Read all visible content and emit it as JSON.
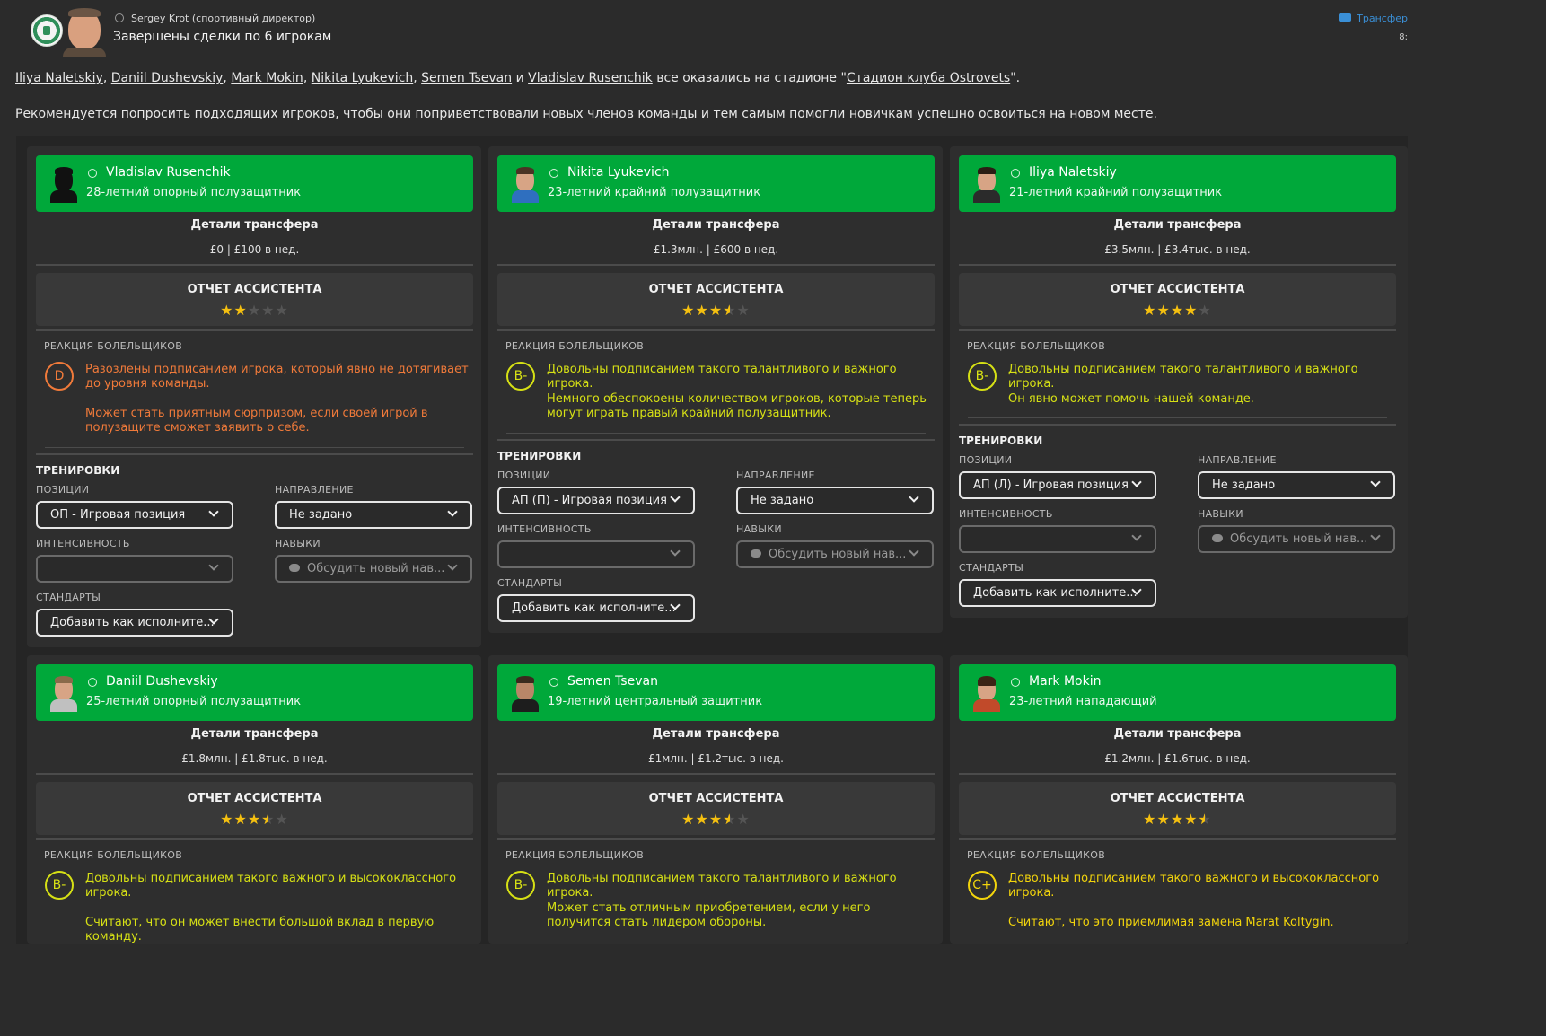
{
  "header": {
    "sender": "Sergey Krot  (спортивный директор)",
    "subject": "Завершены сделки по 6 игрокам",
    "category": "Трансфер",
    "time": "8:"
  },
  "body": {
    "players_line": [
      "Iliya Naletskiy",
      "Daniil Dushevskiy",
      "Mark Mokin",
      "Nikita Lyukevich",
      "Semen Tsevan",
      "Vladislav Rusenchik"
    ],
    "and_word": "и",
    "line1_middle": "все оказались на стадионе \"",
    "stadium": "Стадион клуба Ostrovets",
    "line1_end": "\".",
    "line2": "Рекомендуется попросить подходящих игроков, чтобы они поприветствовали новых членов команды и тем самым помогли новичкам успешно освоиться на новом месте."
  },
  "labels": {
    "transfer_details": "Детали трансфера",
    "assistant_report": "ОТЧЕТ АССИСТЕНТА",
    "fan_reaction": "РЕАКЦИЯ БОЛЕЛЬЩИКОВ",
    "training": "ТРЕНИРОВКИ",
    "positions": "ПОЗИЦИИ",
    "direction": "НАПРАВЛЕНИЕ",
    "intensity": "ИНТЕНСИВНОСТЬ",
    "skills": "НАВЫКИ",
    "set_pieces": "СТАНДАРТЫ"
  },
  "cards": [
    {
      "name": "Vladislav Rusenchik",
      "desc": "28-летний опорный полузащитник",
      "fee": "£0 | £100 в нед.",
      "stars": 2,
      "grade": "D",
      "grade_color": "#f07a3a",
      "reaction1": "Разозлены подписанием игрока, который явно не дотягивает до уровня команды.",
      "reaction2": "Может стать приятным сюрпризом, если своей игрой в полузащите сможет заявить о себе.",
      "position": "ОП - Игровая позиция",
      "direction": "Не задано",
      "intensity": "",
      "skills": "Обсудить новый нав...",
      "set_pieces": "Добавить как исполните..."
    },
    {
      "name": "Nikita Lyukevich",
      "desc": "23-летний крайний полузащитник",
      "fee": "£1.3млн. | £600 в нед.",
      "stars": 3.5,
      "grade": "B-",
      "grade_color": "#d6e015",
      "reaction1": "Довольны подписанием такого талантливого и важного игрока.",
      "reaction2": "Немного обеспокоены количеством игроков, которые теперь могут играть правый крайний полузащитник.",
      "position": "АП (П) - Игровая позиция",
      "direction": "Не задано",
      "intensity": "",
      "skills": "Обсудить новый нав...",
      "set_pieces": "Добавить как исполните..."
    },
    {
      "name": "Iliya Naletskiy",
      "desc": "21-летний крайний полузащитник",
      "fee": "£3.5млн. | £3.4тыс. в нед.",
      "stars": 4,
      "grade": "B-",
      "grade_color": "#d6e015",
      "reaction1": "Довольны подписанием такого талантливого и важного игрока.",
      "reaction2": "Он явно может помочь нашей команде.",
      "position": "АП (Л) - Игровая позиция",
      "direction": "Не задано",
      "intensity": "",
      "skills": "Обсудить новый нав...",
      "set_pieces": "Добавить как исполните..."
    },
    {
      "name": "Daniil Dushevskiy",
      "desc": "25-летний опорный полузащитник",
      "fee": "£1.8млн. | £1.8тыс. в нед.",
      "stars": 3.5,
      "grade": "B-",
      "grade_color": "#d6e015",
      "reaction1": "Довольны подписанием такого важного и высококлассного игрока.",
      "reaction2": "Считают, что он может внести большой вклад в первую команду."
    },
    {
      "name": "Semen Tsevan",
      "desc": "19-летний центральный защитник",
      "fee": "£1млн. | £1.2тыс. в нед.",
      "stars": 3.5,
      "grade": "B-",
      "grade_color": "#d6e015",
      "reaction1": "Довольны подписанием такого талантливого и важного игрока.",
      "reaction2": "Может стать отличным приобретением, если у него получится стать лидером обороны."
    },
    {
      "name": "Mark Mokin",
      "desc": "23-летний нападающий",
      "fee": "£1.2млн. | £1.6тыс. в нед.",
      "stars": 4.5,
      "grade": "C+",
      "grade_color": "#f2d40c",
      "reaction1": "Довольны подписанием такого важного и высококлассного игрока.",
      "reaction2": "Считают, что это приемлимая замена Marat Koltygin."
    }
  ]
}
